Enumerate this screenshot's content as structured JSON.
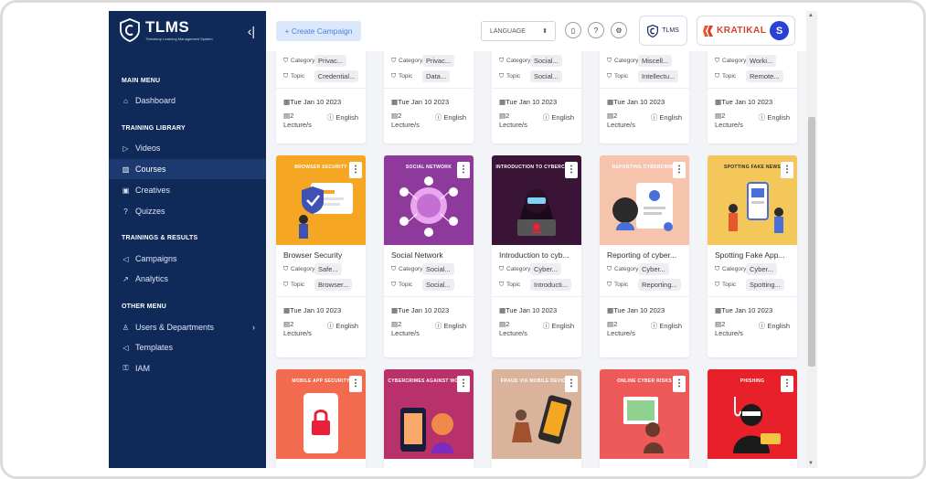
{
  "brand": {
    "title": "TLMS",
    "subtitle": "Threatcop Learning Management System"
  },
  "sidebar": {
    "sections": [
      "MAIN MENU",
      "TRAINING LIBRARY",
      "TRAININGS & RESULTS",
      "OTHER MENU"
    ],
    "items": [
      {
        "label": "Dashboard",
        "icon": "home-icon"
      },
      {
        "label": "Videos",
        "icon": "video-icon"
      },
      {
        "label": "Courses",
        "icon": "book-icon",
        "active": true
      },
      {
        "label": "Creatives",
        "icon": "image-icon"
      },
      {
        "label": "Quizzes",
        "icon": "question-icon"
      },
      {
        "label": "Campaigns",
        "icon": "megaphone-icon"
      },
      {
        "label": "Analytics",
        "icon": "chart-icon"
      },
      {
        "label": "Users & Departments",
        "icon": "user-icon",
        "chevron": "›"
      },
      {
        "label": "Templates",
        "icon": "template-icon"
      },
      {
        "label": "IAM",
        "icon": "key-icon"
      }
    ]
  },
  "topbar": {
    "create_label": "+ Create Campaign",
    "language_label": "LANGUAGE",
    "tlms_badge": "TLMS",
    "org_name": "KRATIKAL",
    "avatar_initial": "S",
    "help_glyph": "?"
  },
  "card_labels": {
    "category": "Category",
    "topic": "Topic"
  },
  "top_row": [
    {
      "category": "Privac...",
      "topic": "Credential...",
      "date": "Tue Jan 10 2023",
      "lectures": "2",
      "lecture_unit": "Lecture/s",
      "language": "English"
    },
    {
      "category": "Privac...",
      "topic": "Data...",
      "date": "Tue Jan 10 2023",
      "lectures": "2",
      "lecture_unit": "Lecture/s",
      "language": "English"
    },
    {
      "category": "Social...",
      "topic": "Social...",
      "date": "Tue Jan 10 2023",
      "lectures": "2",
      "lecture_unit": "Lecture/s",
      "language": "English"
    },
    {
      "category": "Miscell...",
      "topic": "Intellectu...",
      "date": "Tue Jan 10 2023",
      "lectures": "2",
      "lecture_unit": "Lecture/s",
      "language": "English"
    },
    {
      "category": "Worki...",
      "topic": "Remote...",
      "date": "Tue Jan 10 2023",
      "lectures": "2",
      "lecture_unit": "Lecture/s",
      "language": "English"
    }
  ],
  "mid_row": [
    {
      "banner": "BROWSER SECURITY",
      "color": "#f5a623",
      "title": "Browser Security",
      "category": "Safe...",
      "topic": "Browser...",
      "date": "Tue Jan 10 2023",
      "lectures": "2",
      "lecture_unit": "Lecture/s",
      "language": "English"
    },
    {
      "banner": "SOCIAL NETWORK",
      "color": "#8e3a9d",
      "title": "Social Network",
      "category": "Social...",
      "topic": "Social...",
      "date": "Tue Jan 10 2023",
      "lectures": "2",
      "lecture_unit": "Lecture/s",
      "language": "English"
    },
    {
      "banner": "INTRODUCTION TO CYBERCRIME",
      "color": "#3a1437",
      "title": "Introduction to cyb...",
      "category": "Cyber...",
      "topic": "Introducti...",
      "date": "Tue Jan 10 2023",
      "lectures": "2",
      "lecture_unit": "Lecture/s",
      "language": "English"
    },
    {
      "banner": "REPORTING CYBERCRIME",
      "color": "#f6c3ad",
      "title": "Reporting of cyber...",
      "category": "Cyber...",
      "topic": "Reporting...",
      "date": "Tue Jan 10 2023",
      "lectures": "2",
      "lecture_unit": "Lecture/s",
      "language": "English"
    },
    {
      "banner": "SPOTTING FAKE NEWS",
      "color": "#f3c75a",
      "title": "Spotting Fake App...",
      "category": "Cyber...",
      "topic": "Spotting...",
      "date": "Tue Jan 10 2023",
      "lectures": "2",
      "lecture_unit": "Lecture/s",
      "language": "English"
    }
  ],
  "bottom_row": [
    {
      "banner": "MOBILE APP SECURITY",
      "color": "#f26b4f"
    },
    {
      "banner": "CYBERCRIMES AGAINST WOMEN",
      "color": "#b8316a"
    },
    {
      "banner": "FRAUD VIA MOBILE DEVICES",
      "color": "#d9b39c"
    },
    {
      "banner": "ONLINE CYBER RISKS",
      "color": "#ee5a5a"
    },
    {
      "banner": "PHISHING",
      "color": "#e8202a"
    }
  ],
  "colors": {
    "sidebar": "#0f2a59",
    "accent": "#4d7fd8",
    "active_item": "#1d3a70"
  }
}
